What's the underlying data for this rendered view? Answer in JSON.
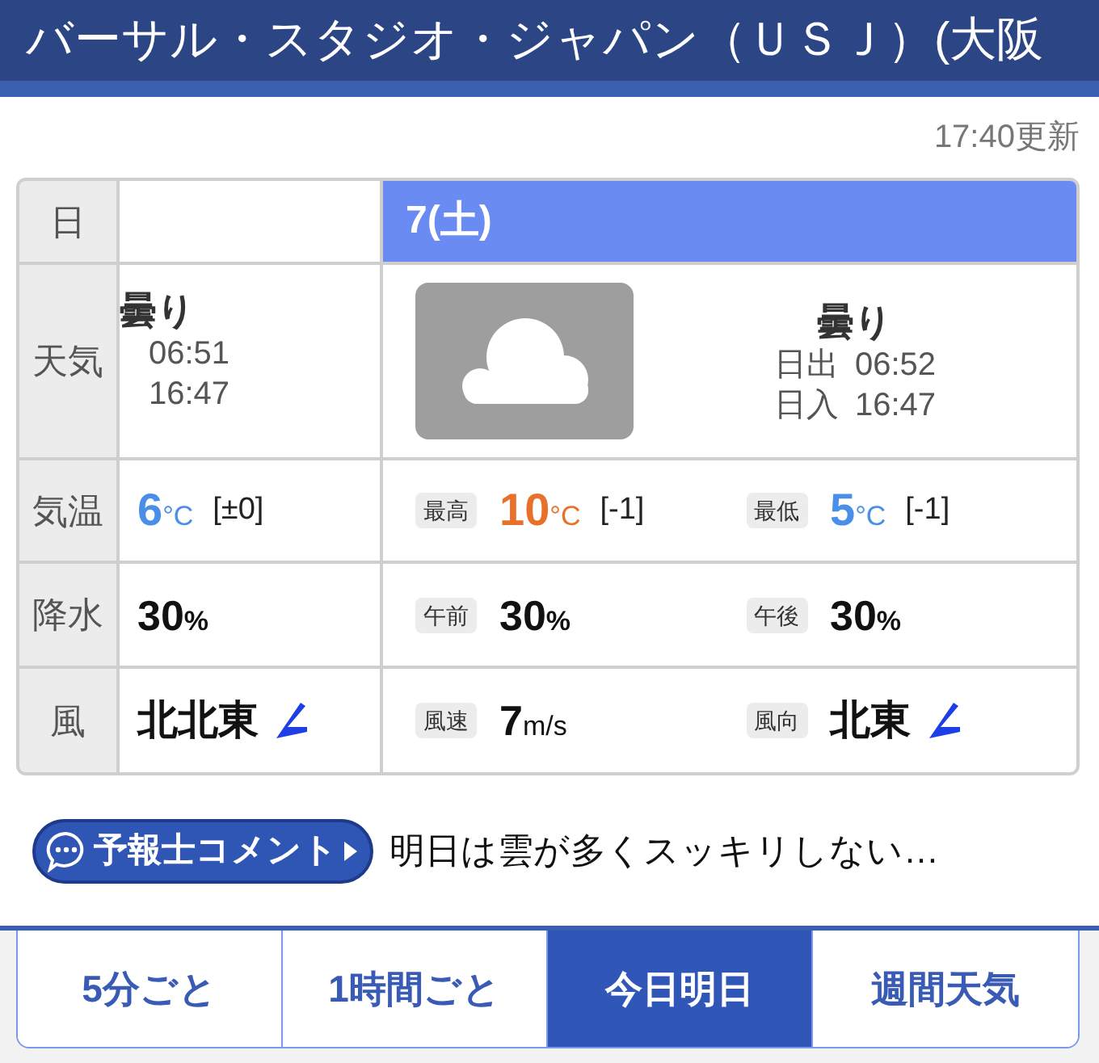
{
  "header": {
    "title": "バーサル・スタジオ・ジャパン（ＵＳＪ）(大阪"
  },
  "updated": "17:40更新",
  "table": {
    "row_labels": [
      "日",
      "天気",
      "気温",
      "降水",
      "風"
    ],
    "days": [
      {
        "kind": "clipped",
        "weather": "曇り",
        "sun": [
          {
            "time": "06:51"
          },
          {
            "time": "16:47"
          }
        ],
        "temperatures": [
          {
            "kind": "low",
            "value": "6",
            "unit": "°C",
            "change": "[±0]"
          }
        ],
        "precipitation": [
          {
            "value": "30",
            "unit": "%"
          }
        ],
        "wind": [
          {
            "kind": "direction",
            "value": "北北東"
          }
        ]
      },
      {
        "kind": "full",
        "date": "7(土)",
        "weather": "曇り",
        "sun": [
          {
            "label": "日出",
            "time": "06:52"
          },
          {
            "label": "日入",
            "time": "16:47"
          }
        ],
        "temperatures": [
          {
            "kind": "high",
            "label": "最高",
            "value": "10",
            "unit": "°C",
            "change": "[-1]"
          },
          {
            "kind": "low",
            "label": "最低",
            "value": "5",
            "unit": "°C",
            "change": "[-1]"
          }
        ],
        "precipitation": [
          {
            "label": "午前",
            "value": "30",
            "unit": "%"
          },
          {
            "label": "午後",
            "value": "30",
            "unit": "%"
          }
        ],
        "wind": [
          {
            "kind": "speed",
            "label": "風速",
            "value": "7",
            "unit": "m/s"
          },
          {
            "kind": "direction",
            "label": "風向",
            "value": "北東"
          }
        ]
      }
    ]
  },
  "comment": {
    "button": "予報士コメント",
    "text": "明日は雲が多くスッキリしない…"
  },
  "nav_tabs": [
    {
      "label": "5分ごと",
      "selected": false
    },
    {
      "label": "1時間ごと",
      "selected": false
    },
    {
      "label": "今日明日",
      "selected": true
    },
    {
      "label": "週間天気",
      "selected": false
    }
  ]
}
